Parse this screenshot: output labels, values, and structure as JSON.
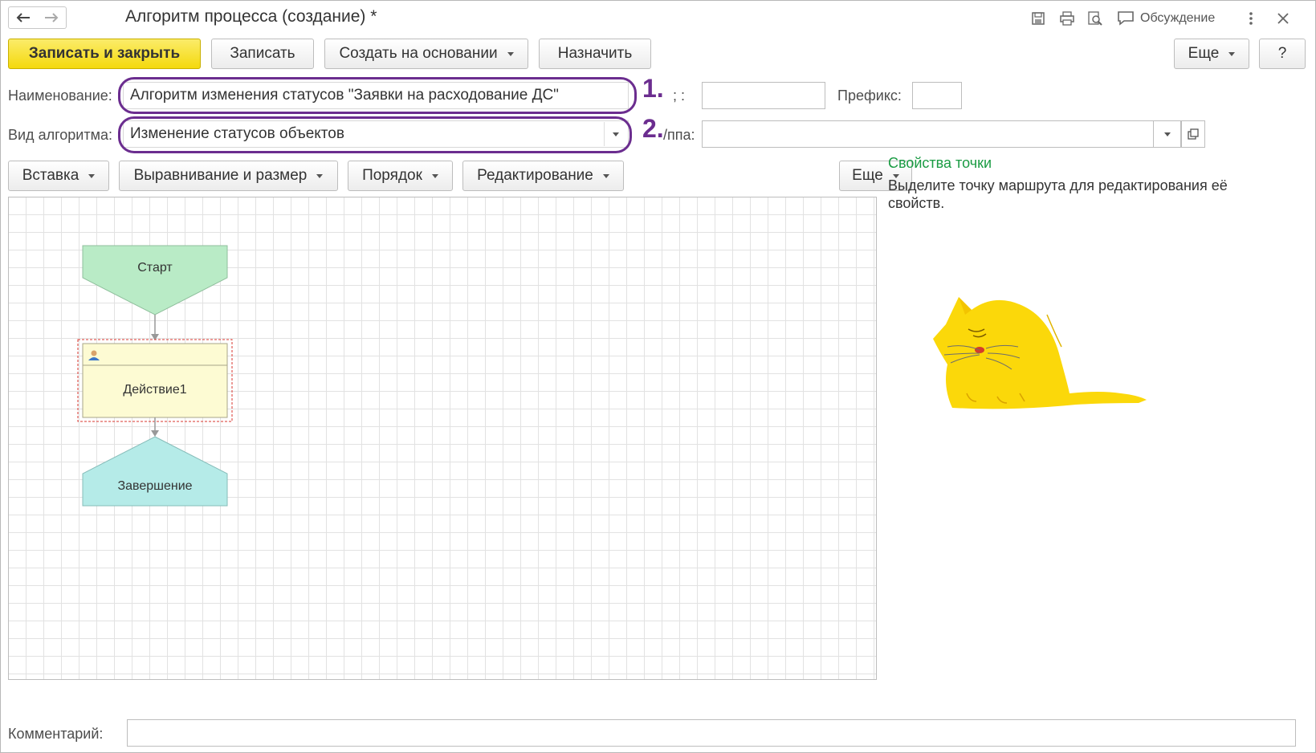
{
  "window": {
    "title": "Алгоритм процесса (создание) *",
    "discussion_label": "Обсуждение"
  },
  "toolbar": {
    "save_close": "Записать и закрыть",
    "save": "Записать",
    "create_based": "Создать на основании",
    "assign": "Назначить",
    "more": "Еще",
    "help": "?"
  },
  "form": {
    "name_label": "Наименование:",
    "name_value": "Алгоритм изменения статусов \"Заявки на расходование ДС\"",
    "code_label_visible": "; :",
    "prefix_label": "Префикс:",
    "prefix_value": "",
    "code_value": "",
    "kind_label": "Вид алгоритма:",
    "kind_value": "Изменение статусов объектов",
    "group_label_visible": "/ппа:",
    "group_value": "",
    "comment_label": "Комментарий:",
    "comment_value": ""
  },
  "annotations": {
    "first": "1.",
    "second": "2."
  },
  "editor_toolbar": {
    "insert": "Вставка",
    "align": "Выравнивание и размер",
    "order": "Порядок",
    "edit": "Редактирование",
    "more": "Еще"
  },
  "diagram": {
    "start": "Старт",
    "action": "Действие1",
    "end": "Завершение"
  },
  "properties": {
    "title": "Свойства точки",
    "hint": "Выделите точку маршрута для редактирования её свойств."
  },
  "colors": {
    "primary_button": "#f4d90d",
    "annotation": "#6b2d8f",
    "props_title": "#1a9b43",
    "start_fill": "#b9ebc6",
    "action_fill": "#fdfbd3",
    "end_fill": "#b5ebe8"
  }
}
